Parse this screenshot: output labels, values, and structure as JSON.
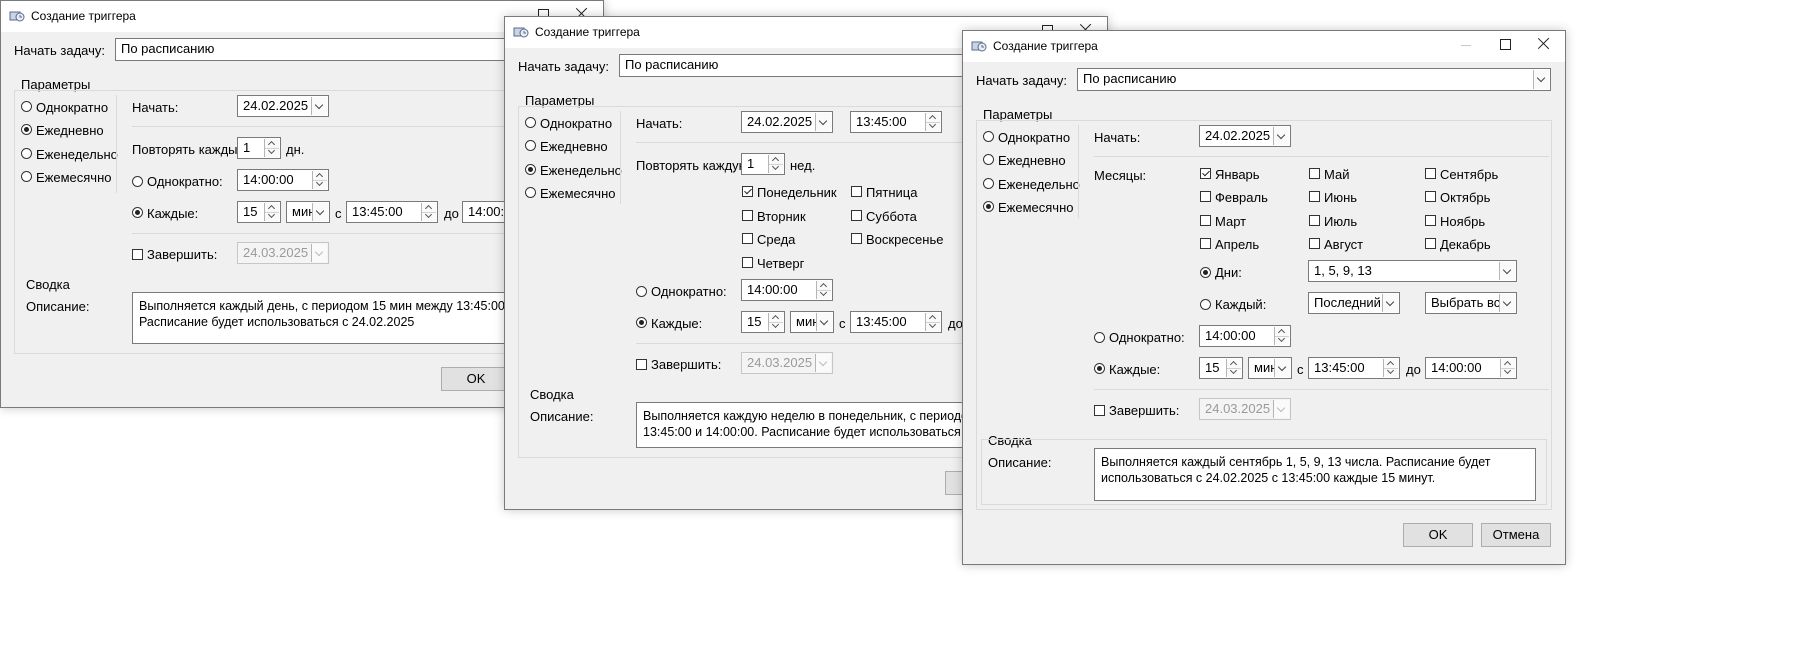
{
  "windows": [
    {
      "title": "Создание триггера",
      "start_task_label": "Начать задачу:",
      "start_task_value": "По расписанию",
      "params_label": "Параметры",
      "schedule_options": [
        "Однократно",
        "Ежедневно",
        "Еженедельно",
        "Ежемесячно"
      ],
      "selected_schedule": "Ежедневно",
      "start_label": "Начать:",
      "start_date": "24.02.2025",
      "repeat_label": "Повторять каждый:",
      "repeat_value": "1",
      "repeat_unit": "дн.",
      "once_label": "Однократно:",
      "once_time": "14:00:00",
      "every_label": "Каждые:",
      "every_value": "15",
      "every_unit": "мин",
      "from_label": "с",
      "from_time": "13:45:00",
      "to_label": "до",
      "to_time": "14:00:00",
      "finish_label": "Завершить:",
      "finish_date": "24.03.2025",
      "summary_label": "Сводка",
      "description_label": "Описание:",
      "description_lines": [
        "Выполняется каждый день, с периодом 15 мин между 13:45:00 и 14:00:00.",
        "Расписание будет использоваться с 24.02.2025"
      ],
      "ok_label": "OK"
    },
    {
      "title": "Создание триггера",
      "start_task_label": "Начать задачу:",
      "start_task_value": "По расписанию",
      "params_label": "Параметры",
      "schedule_options": [
        "Однократно",
        "Ежедневно",
        "Еженедельно",
        "Ежемесячно"
      ],
      "selected_schedule": "Еженедельно",
      "start_label": "Начать:",
      "start_date": "24.02.2025",
      "start_time": "13:45:00",
      "repeat_label": "Повторять каждую:",
      "repeat_value": "1",
      "repeat_unit": "нед.",
      "weekdays": [
        {
          "label": "Понедельник",
          "checked": true
        },
        {
          "label": "Вторник",
          "checked": false
        },
        {
          "label": "Среда",
          "checked": false
        },
        {
          "label": "Четверг",
          "checked": false
        },
        {
          "label": "Пятница",
          "checked": false
        },
        {
          "label": "Суббота",
          "checked": false
        },
        {
          "label": "Воскресенье",
          "checked": false
        }
      ],
      "once_label": "Однократно:",
      "once_time": "14:00:00",
      "every_label": "Каждые:",
      "every_value": "15",
      "every_unit": "мин",
      "from_label": "с",
      "from_time": "13:45:00",
      "to_label": "до",
      "finish_label": "Завершить:",
      "finish_date": "24.03.2025",
      "summary_label": "Сводка",
      "description_label": "Описание:",
      "description_lines": [
        "Выполняется каждую неделю в понедельник, с периодом 15 мин между",
        "13:45:00 и 14:00:00. Расписание будет использоваться с 24.02.2025"
      ]
    },
    {
      "title": "Создание триггера",
      "start_task_label": "Начать задачу:",
      "start_task_value": "По расписанию",
      "params_label": "Параметры",
      "schedule_options": [
        "Однократно",
        "Ежедневно",
        "Еженедельно",
        "Ежемесячно"
      ],
      "selected_schedule": "Ежемесячно",
      "start_label": "Начать:",
      "start_date": "24.02.2025",
      "months_label": "Месяцы:",
      "months": [
        {
          "label": "Январь",
          "checked": true
        },
        {
          "label": "Февраль",
          "checked": false
        },
        {
          "label": "Март",
          "checked": false
        },
        {
          "label": "Апрель",
          "checked": false
        },
        {
          "label": "Май",
          "checked": false
        },
        {
          "label": "Июнь",
          "checked": false
        },
        {
          "label": "Июль",
          "checked": false
        },
        {
          "label": "Август",
          "checked": false
        },
        {
          "label": "Сентябрь",
          "checked": false
        },
        {
          "label": "Октябрь",
          "checked": false
        },
        {
          "label": "Ноябрь",
          "checked": false
        },
        {
          "label": "Декабрь",
          "checked": false
        }
      ],
      "days_label": "Дни:",
      "days_value": "1, 5, 9, 13",
      "each_label": "Каждый:",
      "each_value": "Последний",
      "each_day_value": "Выбрать все",
      "once_label": "Однократно:",
      "once_time": "14:00:00",
      "every_label": "Каждые:",
      "every_value": "15",
      "every_unit": "мин",
      "from_label": "с",
      "from_time": "13:45:00",
      "to_label": "до",
      "to_time": "14:00:00",
      "finish_label": "Завершить:",
      "finish_date": "24.03.2025",
      "summary_label": "Сводка",
      "description_label": "Описание:",
      "description_lines": [
        "Выполняется каждый сентябрь 1, 5, 9, 13 числа. Расписание будет",
        "использоваться с 24.02.2025 с 13:45:00 каждые 15 минут."
      ],
      "ok_label": "OK",
      "cancel_label": "Отмена"
    }
  ]
}
